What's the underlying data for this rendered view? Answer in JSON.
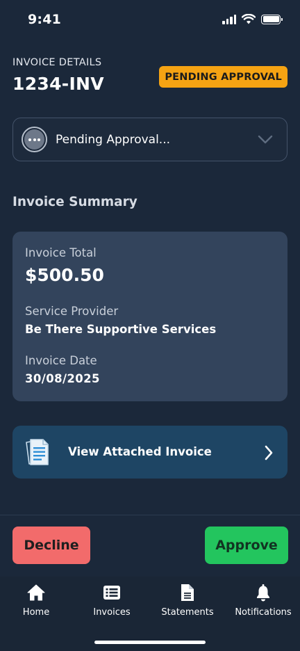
{
  "status_bar": {
    "time": "9:41"
  },
  "header": {
    "label": "INVOICE DETAILS",
    "invoice_number": "1234-INV",
    "status_badge": "PENDING APPROVAL",
    "badge_color": "#f5a313"
  },
  "status_select": {
    "value": "Pending Approval..."
  },
  "summary": {
    "title": "Invoice Summary",
    "total_label": "Invoice Total",
    "total_value": "$500.50",
    "provider_label": "Service Provider",
    "provider_value": "Be There Supportive Services",
    "date_label": "Invoice Date",
    "date_value": "30/08/2025"
  },
  "attachment": {
    "label": "View Attached Invoice"
  },
  "actions": {
    "decline_label": "Decline",
    "approve_label": "Approve",
    "decline_color": "#f26b6b",
    "approve_color": "#23c55e"
  },
  "tab_bar": {
    "items": [
      {
        "label": "Home",
        "icon": "home-icon"
      },
      {
        "label": "Invoices",
        "icon": "list-icon"
      },
      {
        "label": "Statements",
        "icon": "document-icon"
      },
      {
        "label": "Notifications",
        "icon": "bell-icon"
      }
    ]
  },
  "colors": {
    "background": "#1b283a",
    "card": "#33445c",
    "attachment_card": "#1e4564"
  }
}
